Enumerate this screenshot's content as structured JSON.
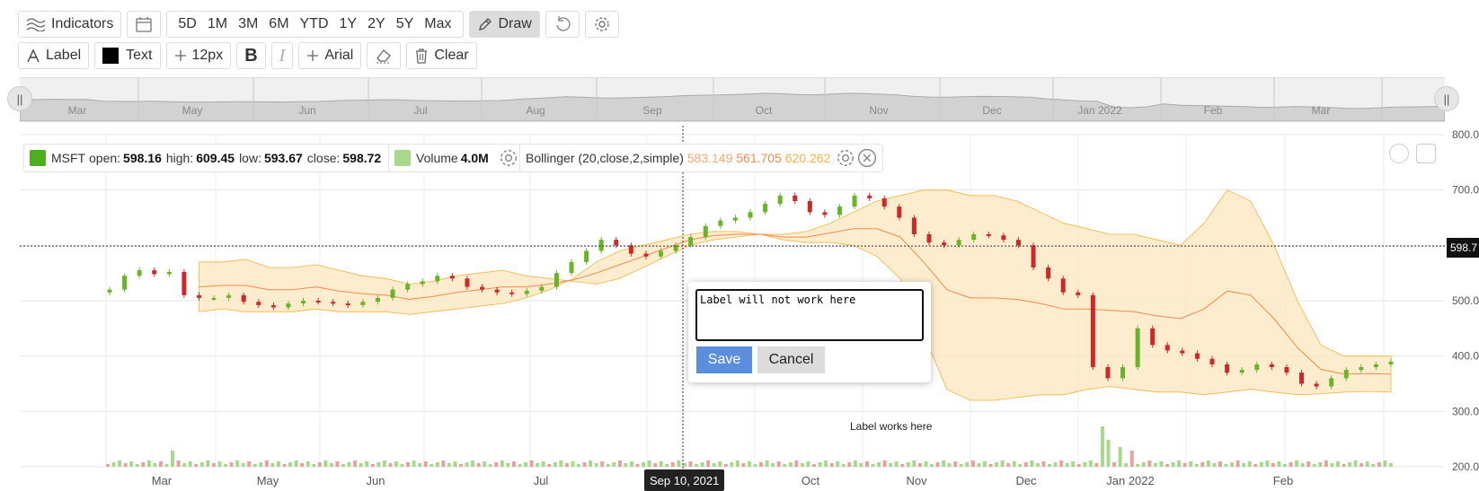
{
  "toolbar1": {
    "indicators": "Indicators",
    "ranges": [
      "5D",
      "1M",
      "3M",
      "6M",
      "YTD",
      "1Y",
      "2Y",
      "5Y",
      "Max"
    ],
    "draw": "Draw"
  },
  "toolbar2": {
    "label": "Label",
    "text": "Text",
    "size": "12px",
    "font": "Arial",
    "clear": "Clear"
  },
  "navigator": {
    "months": [
      "Mar",
      "May",
      "Jun",
      "Jul",
      "Aug",
      "Sep",
      "Oct",
      "Nov",
      "Dec",
      "Jan 2022",
      "Feb",
      "Mar"
    ]
  },
  "legend": {
    "symbol": "MSFT",
    "open_label": "open:",
    "open": "598.16",
    "high_label": "high:",
    "high": "609.45",
    "low_label": "low:",
    "low": "593.67",
    "close_label": "close:",
    "close": "598.72",
    "volume_label": "Volume",
    "volume": "4.0M",
    "bollinger_label": "Bollinger (20,close,2,simple)",
    "boll_lower": "583.149",
    "boll_mid": "561.705",
    "boll_upper": "620.262"
  },
  "dialog": {
    "value": "Label will not work here",
    "save": "Save",
    "cancel": "Cancel"
  },
  "note": "Label works here",
  "crosshair": {
    "date": "Sep 10, 2021",
    "price": "598.7"
  },
  "colors": {
    "up": "#6ab42a",
    "down": "#cc2a2a",
    "band_fill": "#fde7c2",
    "band_line": "#f5b441",
    "mid_line": "#f08b4c",
    "vol_up": "#a8d98a",
    "vol_down": "#e8a0a0",
    "legend_green": "#4caf1e",
    "legend_lightgreen": "#a8d98a"
  },
  "chart_data": {
    "type": "candlestick",
    "x_axis_labels": [
      "Mar",
      "May",
      "Jun",
      "Jul",
      "Sep 10, 2021",
      "Oct",
      "Nov",
      "Dec",
      "Jan 2022",
      "Feb"
    ],
    "y_axis_labels": [
      "800.0",
      "700.0",
      "600.0",
      "500.0",
      "400.0",
      "300.0",
      "200.0"
    ],
    "ylim": [
      200,
      800
    ],
    "close_series": [
      520,
      545,
      555,
      548,
      552,
      510,
      505,
      505,
      510,
      498,
      492,
      488,
      495,
      500,
      498,
      495,
      492,
      498,
      505,
      520,
      530,
      535,
      545,
      540,
      525,
      520,
      515,
      512,
      518,
      525,
      550,
      570,
      590,
      610,
      600,
      585,
      580,
      590,
      600,
      615,
      635,
      645,
      650,
      660,
      675,
      690,
      680,
      660,
      655,
      670,
      690,
      685,
      670,
      650,
      620,
      605,
      600,
      610,
      620,
      618,
      610,
      600,
      560,
      540,
      515,
      510,
      380,
      360,
      380,
      450,
      420,
      410,
      405,
      395,
      385,
      370,
      375,
      385,
      380,
      370,
      350,
      345,
      360,
      375,
      380,
      385,
      390
    ],
    "bollinger_upper": [
      570,
      570,
      575,
      560,
      560,
      565,
      555,
      545,
      540,
      530,
      535,
      545,
      550,
      555,
      545,
      540,
      535,
      530,
      540,
      560,
      580,
      600,
      610,
      615,
      620,
      620,
      625,
      640,
      660,
      680,
      690,
      700,
      700,
      690,
      690,
      680,
      660,
      640,
      630,
      620,
      620,
      610,
      600,
      640,
      700,
      680,
      600,
      500,
      420,
      400,
      400,
      400
    ],
    "bollinger_lower": [
      480,
      485,
      480,
      480,
      480,
      485,
      480,
      480,
      480,
      475,
      480,
      485,
      490,
      495,
      505,
      520,
      540,
      570,
      590,
      600,
      610,
      620,
      625,
      625,
      620,
      610,
      605,
      605,
      600,
      580,
      540,
      440,
      340,
      320,
      320,
      325,
      330,
      330,
      340,
      345,
      340,
      335,
      335,
      330,
      335,
      340,
      335,
      330,
      332,
      335,
      336,
      335
    ],
    "volume_spike_labels": [
      "Mar",
      "Jan 2022"
    ]
  }
}
